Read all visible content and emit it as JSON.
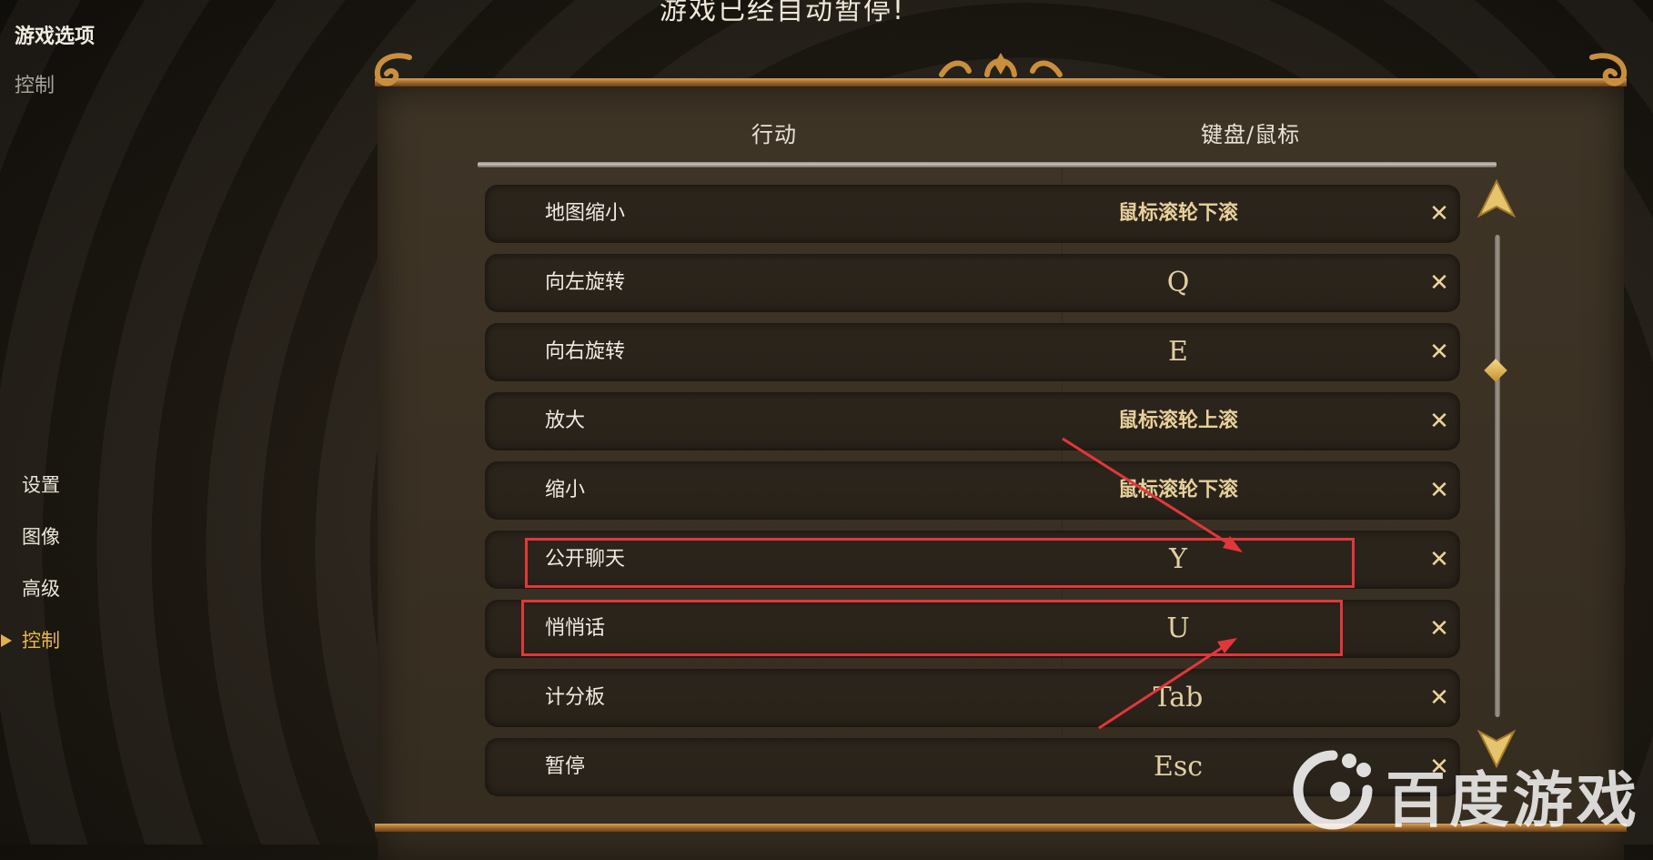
{
  "sidebar_top": {
    "title": "游戏选项",
    "subtitle": "控制"
  },
  "pause_title": "游戏已经自动暂停!",
  "menu": [
    {
      "label": "设置",
      "active": false
    },
    {
      "label": "图像",
      "active": false
    },
    {
      "label": "高级",
      "active": false
    },
    {
      "label": "控制",
      "active": true
    }
  ],
  "table": {
    "header_action": "行动",
    "header_binding": "键盘/鼠标",
    "rows": [
      {
        "action": "地图缩小",
        "binding": "鼠标滚轮下滚"
      },
      {
        "action": "向左旋转",
        "binding": "Q"
      },
      {
        "action": "向右旋转",
        "binding": "E"
      },
      {
        "action": "放大",
        "binding": "鼠标滚轮上滚"
      },
      {
        "action": "缩小",
        "binding": "鼠标滚轮下滚"
      },
      {
        "action": "公开聊天",
        "binding": "Y"
      },
      {
        "action": "悄悄话",
        "binding": "U"
      },
      {
        "action": "计分板",
        "binding": "Tab"
      },
      {
        "action": "暂停",
        "binding": "Esc"
      }
    ],
    "clear_symbol": "✕"
  },
  "watermark": "百度游戏",
  "colors": {
    "accent_gold": "#e9b84a",
    "annotation_red": "#e2373a",
    "panel_bg": "#3a3124",
    "row_bg": "#2a231a"
  },
  "icons": [
    "arrow-up-icon",
    "arrow-down-icon",
    "close-icon",
    "baidu-logo-icon"
  ]
}
